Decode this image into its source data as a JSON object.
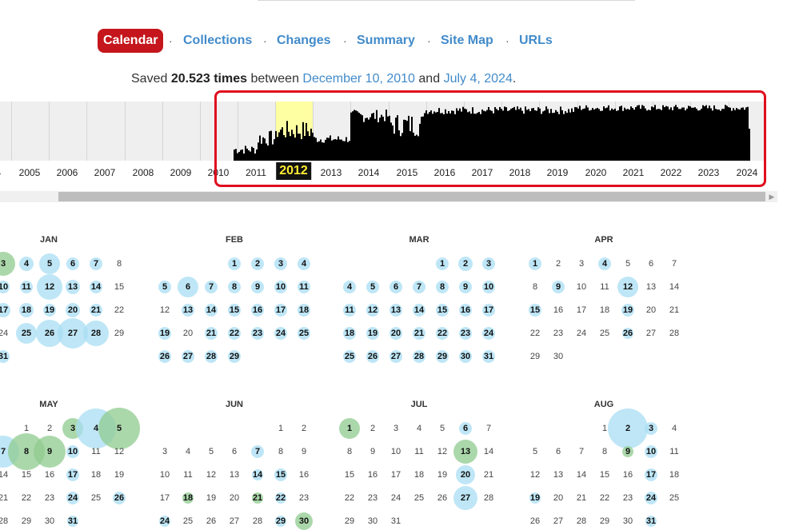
{
  "nav": {
    "items": [
      "Calendar",
      "Collections",
      "Changes",
      "Summary",
      "Site Map",
      "URLs"
    ],
    "separator": "·"
  },
  "summary": {
    "prefix": "Saved",
    "count": "20.523 times",
    "between": "between",
    "first_date": "December 10, 2010",
    "and": "and",
    "last_date": "July 4, 2024",
    "period": "."
  },
  "timeline": {
    "years": [
      "4",
      "2005",
      "2006",
      "2007",
      "2008",
      "2009",
      "2010",
      "2011",
      "2012",
      "2013",
      "2014",
      "2015",
      "2016",
      "2017",
      "2018",
      "2019",
      "2020",
      "2021",
      "2022",
      "2023",
      "2024"
    ],
    "selected_year": "2012",
    "highlight_color": "#ffff99",
    "bar_color": "#000000",
    "annotation_color": "#e00d1e"
  },
  "months": [
    {
      "name": "JAN"
    },
    {
      "name": "FEB"
    },
    {
      "name": "MAR"
    },
    {
      "name": "APR"
    },
    {
      "name": "MAY"
    },
    {
      "name": "JUN"
    },
    {
      "name": "JUL"
    },
    {
      "name": "AUG"
    }
  ]
}
